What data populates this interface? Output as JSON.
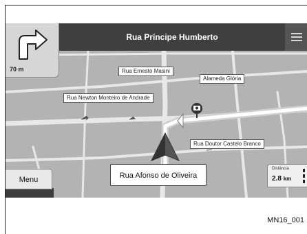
{
  "nav": {
    "street_title": "Rua Príncipe Humberto",
    "turn_distance": "70 m",
    "current_street": "Rua Afonso de Oliveira",
    "menu_label": "Menu",
    "distance_label": "Distância",
    "distance_value": "2.8",
    "distance_unit": "km",
    "icons": [
      "turn-right-icon",
      "menu-lines-icon",
      "poi-camera-icon",
      "position-arrow-icon",
      "more-dots-icon"
    ]
  },
  "map_labels": {
    "ernesto": "Rua Ernesto Masini",
    "gloria": "Alameda Glória",
    "newton": "Rua Newton Monteiro de Andrade",
    "castelo": "Rua Doutor Castelo Branco"
  },
  "figure_code": "MN16_001"
}
